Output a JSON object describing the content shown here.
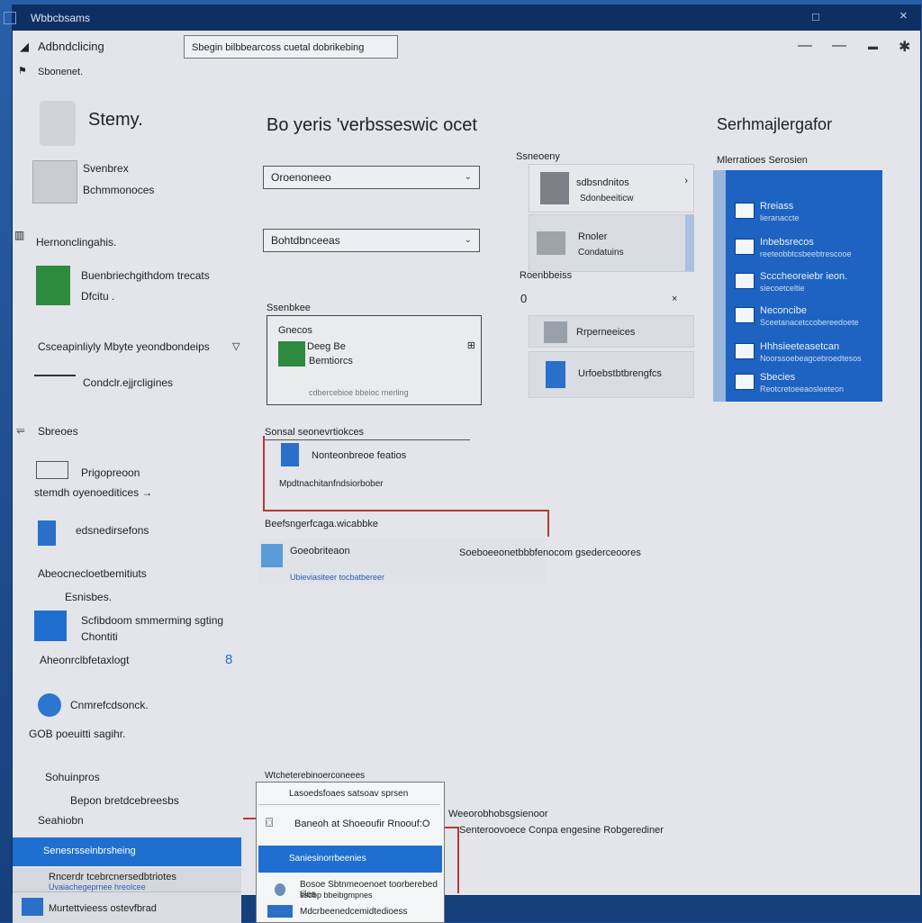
{
  "window": {
    "title": "Wbbcbsams",
    "close": "×",
    "maximize": "□"
  },
  "toolbar": {
    "breadcrumb": "Adbndclicing",
    "subnav": "Sbonenet.",
    "search_placeholder": "Sbegin bilbbearcoss cuetal dobrikebing",
    "ctrl_minimize": "—",
    "ctrl_min2": "—",
    "ctrl_min3": "▬",
    "ctrl_gear": "✱"
  },
  "left": {
    "hero_title": "Stemy.",
    "items": [
      {
        "title": "Svenbrex",
        "sub": "Bchmmonoces"
      },
      {
        "title": "Hernonclingahis."
      },
      {
        "title": "Buenbriechgithdom trecats",
        "sub": "Dfcitu ."
      },
      {
        "title": "Csceapinliyly Mbyte yeondbondeips"
      },
      {
        "title": "Condclr.ejjrcligines"
      },
      {
        "title": "Sbreoes"
      },
      {
        "title": "Prigopreoon",
        "sub": "stemdh oyenoeditices →"
      },
      {
        "title": "edsnedirsefons"
      },
      {
        "title": "Abeocnecloetbemitiuts",
        "sub": "Esnisbes."
      },
      {
        "title": "Scfibdoom smmerming sgting",
        "sub": "Chontiti"
      },
      {
        "title": "Aheonrclbfetaxlogt",
        "badge": "8"
      },
      {
        "title": "Cnmrefcdsonck."
      },
      {
        "title": "GOB poeuitti sagihr."
      },
      {
        "title": "Sohuinpros"
      },
      {
        "title": "Bepon bretdcebreesbs"
      },
      {
        "title": "Seahiobn"
      }
    ],
    "selected": "Senesrsseinbrsheing",
    "bottom1": "Rncerdr tcebrcnersedbtriotes",
    "bottom1_sub": "Uvaiachegeprnee hreolcee",
    "bottom2": "Murtettvieess ostevfbrad"
  },
  "center": {
    "title": "Bo yeris 'verbsseswic ocet",
    "select1": "Oroenoneeo",
    "select2": "Bohtdbnceeas",
    "section_label": "Ssenbkee",
    "card": {
      "heading": "Gnecos",
      "line1": "Deeg Be",
      "line2": "Bemtiorcs",
      "foot": "cdbercebioe bbeioc rnerling"
    },
    "settings_label": "Sonsal seonevrtiokces",
    "row1": "Nonteonbreoe featios",
    "row1_sub": "Mpdtnachitanfndsiorbober",
    "section2_label": "Beefsngerfcaga.wicabbke",
    "row2": "Goeobriteaon",
    "row2_right": "Soeboeeonetbbbfenocom gsederceoores",
    "row2_sub": "Ubieviasiteer tocbatbereer",
    "bottom_label": "Wtcheterebinoerconeees",
    "right_note": "Weeorobhobsgsienoor",
    "right_note2": "Senteroovoece Conpa engesine Robgerediner",
    "popup": {
      "r1": "Lasoedsfoaes satsoav sprsen",
      "r2": "Baneoh at Shoeoufir Rnoouf:O",
      "r3": "Saniesinorrbeenies",
      "r4": "Bosoe Sbtnmeoenoet toorberebed tiles",
      "r4_sub": "ssobp bbeibgmpnes",
      "r5": "Mdcrbeenedcemidtedioess"
    }
  },
  "mid": {
    "label": "Ssneoeny",
    "items": [
      {
        "title": "sdbsndnitos",
        "sub": "Sdonbeeiticw"
      },
      {
        "title": "Rnoler",
        "sub": "Condatuins"
      }
    ],
    "label2": "Roenbbeiss",
    "value": "0",
    "items2": [
      {
        "title": "Rrperneeices"
      },
      {
        "title": "Urfoebstbtbrengfcs"
      }
    ]
  },
  "right": {
    "title": "Serhmajlergafor",
    "subtitle": "Mlerratioes Serosien",
    "panel": [
      {
        "t": "Rreiass",
        "s": "lieranaccte"
      },
      {
        "t": "Inbebsrecos",
        "s": "reeteobbtcsbeebtrescooe"
      },
      {
        "t": "Scccheoreiebr ieon.",
        "s": "siecoetceltie"
      },
      {
        "t": "Neconcibe",
        "s": "Sceetanacetccobereedoete"
      },
      {
        "t": "Hhhsieeteasetcan",
        "s": "Noorssoebeagcebroedtesos"
      },
      {
        "t": "Sbecies",
        "s": "Reotcretoeeaosleeteon"
      }
    ]
  },
  "colors": {
    "accent": "#1f6fd0",
    "titlebar": "#0d2f63",
    "panel_blue": "#1e63c2"
  }
}
